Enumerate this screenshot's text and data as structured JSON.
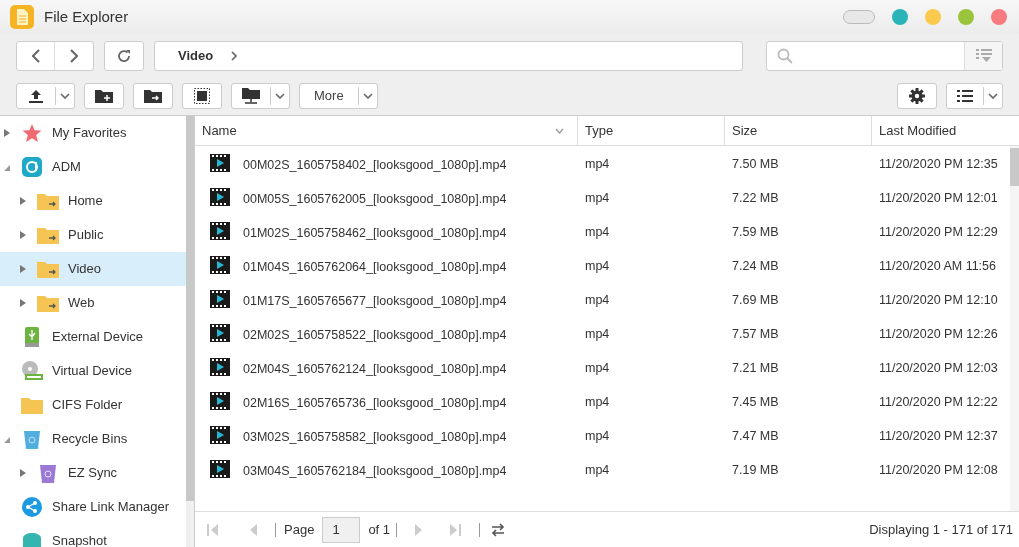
{
  "window": {
    "title": "File Explorer"
  },
  "window_controls": [
    {
      "kind": "pill"
    },
    {
      "kind": "dot",
      "color": "#2ab4b8"
    },
    {
      "kind": "dot",
      "color": "#fbc94e"
    },
    {
      "kind": "dot",
      "color": "#9ac43c"
    },
    {
      "kind": "dot",
      "color": "#f77b7e"
    }
  ],
  "breadcrumb": {
    "path": "Video"
  },
  "toolbar": [
    {
      "kind": "upload",
      "dropdown": true
    },
    {
      "kind": "new-folder",
      "dropdown": false
    },
    {
      "kind": "move-folder",
      "dropdown": false
    },
    {
      "kind": "select",
      "dropdown": false
    },
    {
      "kind": "network",
      "dropdown": true
    },
    {
      "kind": "text",
      "label": "More",
      "dropdown": true
    }
  ],
  "sidebar": {
    "items": [
      {
        "label": "My Favorites",
        "kind": "star",
        "expanded": false,
        "selected": false
      },
      {
        "label": "ADM",
        "kind": "adm",
        "expanded": true,
        "selected": false,
        "children": [
          {
            "label": "Home",
            "kind": "share",
            "expanded": false,
            "selected": false
          },
          {
            "label": "Public",
            "kind": "share",
            "expanded": false,
            "selected": false
          },
          {
            "label": "Video",
            "kind": "share",
            "expanded": false,
            "selected": true
          },
          {
            "label": "Web",
            "kind": "share",
            "expanded": false,
            "selected": false
          }
        ]
      },
      {
        "label": "External Device",
        "kind": "usb",
        "selected": false
      },
      {
        "label": "Virtual Device",
        "kind": "disc",
        "selected": false
      },
      {
        "label": "CIFS Folder",
        "kind": "folder",
        "selected": false
      },
      {
        "label": "Recycle Bins",
        "kind": "bin",
        "expanded": true,
        "selected": false,
        "children": [
          {
            "label": "EZ Sync",
            "kind": "bin-purple",
            "expanded": false,
            "selected": false
          }
        ]
      },
      {
        "label": "Share Link Manager",
        "kind": "share-link",
        "selected": false
      },
      {
        "label": "Snapshot",
        "kind": "snapshot",
        "selected": false
      }
    ]
  },
  "table": {
    "columns": [
      "Name",
      "Type",
      "Size",
      "Last Modified"
    ],
    "rows": [
      [
        "00M02S_1605758402_[looksgood_1080p].mp4",
        "mp4",
        "7.50 MB",
        "11/20/2020 PM 12:35"
      ],
      [
        "00M05S_1605762005_[looksgood_1080p].mp4",
        "mp4",
        "7.22 MB",
        "11/20/2020 PM 12:01"
      ],
      [
        "01M02S_1605758462_[looksgood_1080p].mp4",
        "mp4",
        "7.59 MB",
        "11/20/2020 PM 12:29"
      ],
      [
        "01M04S_1605762064_[looksgood_1080p].mp4",
        "mp4",
        "7.24 MB",
        "11/20/2020 AM 11:56"
      ],
      [
        "01M17S_1605765677_[looksgood_1080p].mp4",
        "mp4",
        "7.69 MB",
        "11/20/2020 PM 12:10"
      ],
      [
        "02M02S_1605758522_[looksgood_1080p].mp4",
        "mp4",
        "7.57 MB",
        "11/20/2020 PM 12:26"
      ],
      [
        "02M04S_1605762124_[looksgood_1080p].mp4",
        "mp4",
        "7.21 MB",
        "11/20/2020 PM 12:03"
      ],
      [
        "02M16S_1605765736_[looksgood_1080p].mp4",
        "mp4",
        "7.45 MB",
        "11/20/2020 PM 12:22"
      ],
      [
        "03M02S_1605758582_[looksgood_1080p].mp4",
        "mp4",
        "7.47 MB",
        "11/20/2020 PM 12:37"
      ],
      [
        "03M04S_1605762184_[looksgood_1080p].mp4",
        "mp4",
        "7.19 MB",
        "11/20/2020 PM 12:08"
      ]
    ]
  },
  "pager": {
    "page_label": "Page",
    "page": "1",
    "of": "of 1",
    "status": "Displaying 1 - 171 of 171"
  }
}
